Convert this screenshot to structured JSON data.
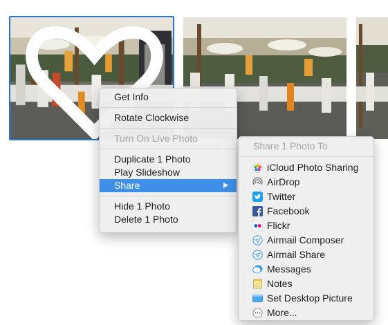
{
  "context_menu": {
    "items": {
      "get_info": "Get Info",
      "rotate": "Rotate Clockwise",
      "live_photo": "Turn On Live Photo",
      "duplicate": "Duplicate 1 Photo",
      "slideshow": "Play Slideshow",
      "share": "Share",
      "hide": "Hide 1 Photo",
      "delete": "Delete 1 Photo"
    }
  },
  "share_menu": {
    "header": "Share 1 Photo To",
    "items": [
      {
        "label": "iCloud Photo Sharing",
        "icon": "icloud-photo-sharing-icon"
      },
      {
        "label": "AirDrop",
        "icon": "airdrop-icon"
      },
      {
        "label": "Twitter",
        "icon": "twitter-icon"
      },
      {
        "label": "Facebook",
        "icon": "facebook-icon"
      },
      {
        "label": "Flickr",
        "icon": "flickr-icon"
      },
      {
        "label": "Airmail Composer",
        "icon": "airmail-icon"
      },
      {
        "label": "Airmail Share",
        "icon": "airmail-icon"
      },
      {
        "label": "Messages",
        "icon": "messages-icon"
      },
      {
        "label": "Notes",
        "icon": "notes-icon"
      },
      {
        "label": "Set Desktop Picture",
        "icon": "desktop-picture-icon"
      },
      {
        "label": "More...",
        "icon": "more-icon"
      }
    ]
  },
  "colors": {
    "selection_border": "#2a76d4",
    "menu_highlight": "#3f8fe8",
    "twitter": "#1da1f2",
    "facebook": "#3b5998"
  }
}
